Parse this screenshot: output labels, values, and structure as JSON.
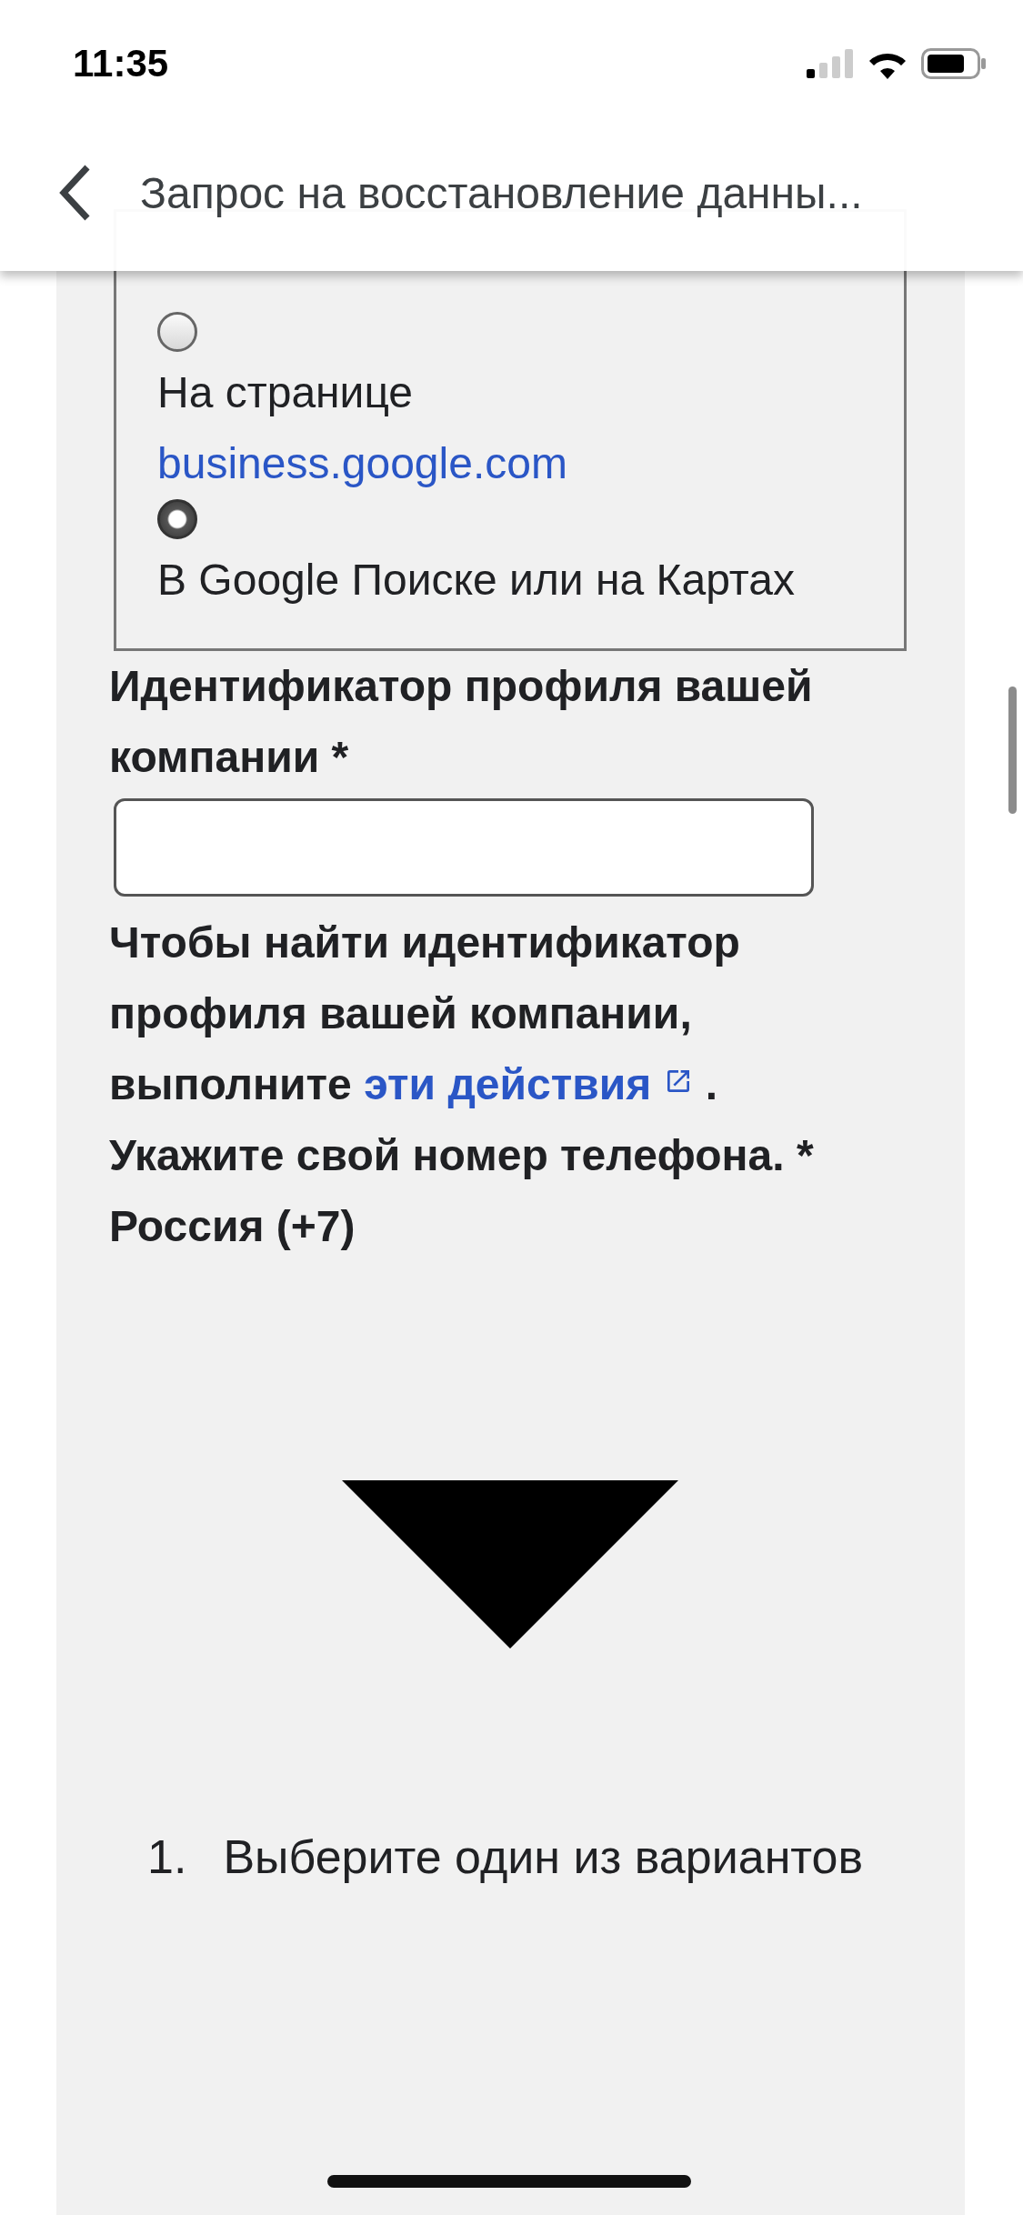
{
  "status_bar": {
    "time": "11:35"
  },
  "header": {
    "title": "Запрос на восстановление данны..."
  },
  "management": {
    "options": [
      {
        "label": "На странице",
        "link": "business.google.com",
        "selected": false
      },
      {
        "label": "В Google Поиске или на Картах",
        "selected": true
      }
    ]
  },
  "profile_id": {
    "label": "Идентификатор профиля вашей компании *",
    "help_before": "Чтобы найти идентификатор профиля вашей компании, выполните",
    "help_link": "эти действия",
    "help_after": "."
  },
  "phone": {
    "label": "Укажите свой номер телефона. *",
    "country": "Россия (+7)"
  },
  "steps": [
    {
      "number": "1.",
      "text": "Выберите один из вариантов"
    }
  ]
}
